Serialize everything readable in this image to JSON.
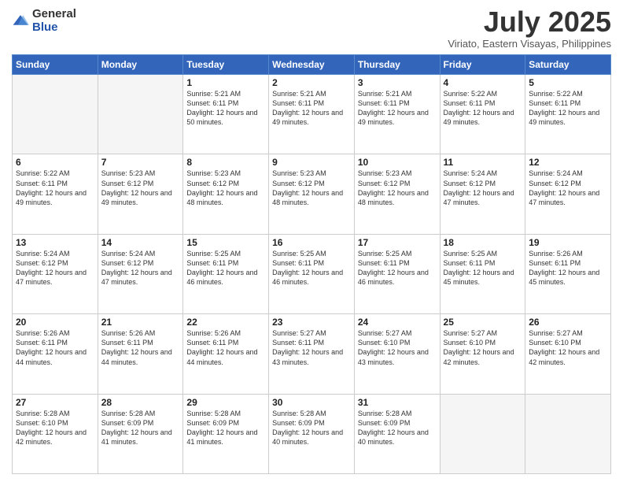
{
  "header": {
    "logo_general": "General",
    "logo_blue": "Blue",
    "title": "July 2025",
    "location": "Viriato, Eastern Visayas, Philippines"
  },
  "days_of_week": [
    "Sunday",
    "Monday",
    "Tuesday",
    "Wednesday",
    "Thursday",
    "Friday",
    "Saturday"
  ],
  "weeks": [
    [
      {
        "day": "",
        "info": ""
      },
      {
        "day": "",
        "info": ""
      },
      {
        "day": "1",
        "info": "Sunrise: 5:21 AM\nSunset: 6:11 PM\nDaylight: 12 hours and 50 minutes."
      },
      {
        "day": "2",
        "info": "Sunrise: 5:21 AM\nSunset: 6:11 PM\nDaylight: 12 hours and 49 minutes."
      },
      {
        "day": "3",
        "info": "Sunrise: 5:21 AM\nSunset: 6:11 PM\nDaylight: 12 hours and 49 minutes."
      },
      {
        "day": "4",
        "info": "Sunrise: 5:22 AM\nSunset: 6:11 PM\nDaylight: 12 hours and 49 minutes."
      },
      {
        "day": "5",
        "info": "Sunrise: 5:22 AM\nSunset: 6:11 PM\nDaylight: 12 hours and 49 minutes."
      }
    ],
    [
      {
        "day": "6",
        "info": "Sunrise: 5:22 AM\nSunset: 6:11 PM\nDaylight: 12 hours and 49 minutes."
      },
      {
        "day": "7",
        "info": "Sunrise: 5:23 AM\nSunset: 6:12 PM\nDaylight: 12 hours and 49 minutes."
      },
      {
        "day": "8",
        "info": "Sunrise: 5:23 AM\nSunset: 6:12 PM\nDaylight: 12 hours and 48 minutes."
      },
      {
        "day": "9",
        "info": "Sunrise: 5:23 AM\nSunset: 6:12 PM\nDaylight: 12 hours and 48 minutes."
      },
      {
        "day": "10",
        "info": "Sunrise: 5:23 AM\nSunset: 6:12 PM\nDaylight: 12 hours and 48 minutes."
      },
      {
        "day": "11",
        "info": "Sunrise: 5:24 AM\nSunset: 6:12 PM\nDaylight: 12 hours and 47 minutes."
      },
      {
        "day": "12",
        "info": "Sunrise: 5:24 AM\nSunset: 6:12 PM\nDaylight: 12 hours and 47 minutes."
      }
    ],
    [
      {
        "day": "13",
        "info": "Sunrise: 5:24 AM\nSunset: 6:12 PM\nDaylight: 12 hours and 47 minutes."
      },
      {
        "day": "14",
        "info": "Sunrise: 5:24 AM\nSunset: 6:12 PM\nDaylight: 12 hours and 47 minutes."
      },
      {
        "day": "15",
        "info": "Sunrise: 5:25 AM\nSunset: 6:11 PM\nDaylight: 12 hours and 46 minutes."
      },
      {
        "day": "16",
        "info": "Sunrise: 5:25 AM\nSunset: 6:11 PM\nDaylight: 12 hours and 46 minutes."
      },
      {
        "day": "17",
        "info": "Sunrise: 5:25 AM\nSunset: 6:11 PM\nDaylight: 12 hours and 46 minutes."
      },
      {
        "day": "18",
        "info": "Sunrise: 5:25 AM\nSunset: 6:11 PM\nDaylight: 12 hours and 45 minutes."
      },
      {
        "day": "19",
        "info": "Sunrise: 5:26 AM\nSunset: 6:11 PM\nDaylight: 12 hours and 45 minutes."
      }
    ],
    [
      {
        "day": "20",
        "info": "Sunrise: 5:26 AM\nSunset: 6:11 PM\nDaylight: 12 hours and 44 minutes."
      },
      {
        "day": "21",
        "info": "Sunrise: 5:26 AM\nSunset: 6:11 PM\nDaylight: 12 hours and 44 minutes."
      },
      {
        "day": "22",
        "info": "Sunrise: 5:26 AM\nSunset: 6:11 PM\nDaylight: 12 hours and 44 minutes."
      },
      {
        "day": "23",
        "info": "Sunrise: 5:27 AM\nSunset: 6:11 PM\nDaylight: 12 hours and 43 minutes."
      },
      {
        "day": "24",
        "info": "Sunrise: 5:27 AM\nSunset: 6:10 PM\nDaylight: 12 hours and 43 minutes."
      },
      {
        "day": "25",
        "info": "Sunrise: 5:27 AM\nSunset: 6:10 PM\nDaylight: 12 hours and 42 minutes."
      },
      {
        "day": "26",
        "info": "Sunrise: 5:27 AM\nSunset: 6:10 PM\nDaylight: 12 hours and 42 minutes."
      }
    ],
    [
      {
        "day": "27",
        "info": "Sunrise: 5:28 AM\nSunset: 6:10 PM\nDaylight: 12 hours and 42 minutes."
      },
      {
        "day": "28",
        "info": "Sunrise: 5:28 AM\nSunset: 6:09 PM\nDaylight: 12 hours and 41 minutes."
      },
      {
        "day": "29",
        "info": "Sunrise: 5:28 AM\nSunset: 6:09 PM\nDaylight: 12 hours and 41 minutes."
      },
      {
        "day": "30",
        "info": "Sunrise: 5:28 AM\nSunset: 6:09 PM\nDaylight: 12 hours and 40 minutes."
      },
      {
        "day": "31",
        "info": "Sunrise: 5:28 AM\nSunset: 6:09 PM\nDaylight: 12 hours and 40 minutes."
      },
      {
        "day": "",
        "info": ""
      },
      {
        "day": "",
        "info": ""
      }
    ]
  ]
}
